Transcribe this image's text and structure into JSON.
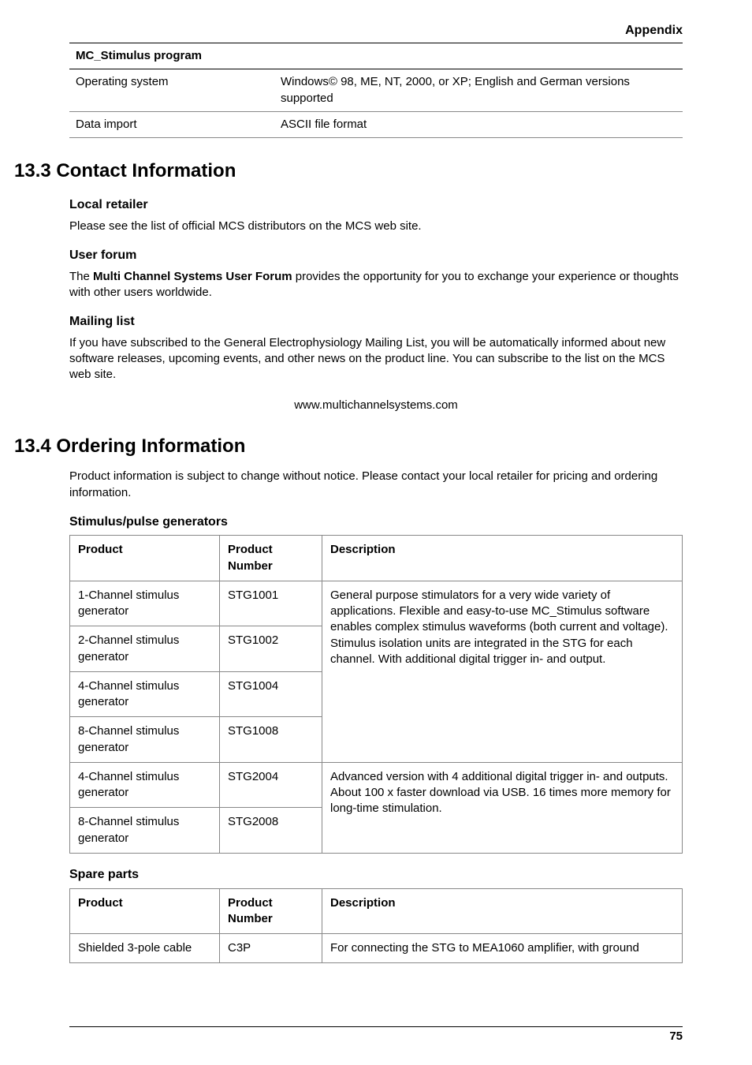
{
  "header": {
    "section": "Appendix"
  },
  "table1": {
    "title": "MC_Stimulus program",
    "rows": [
      {
        "k": "Operating system",
        "v": "Windows© 98, ME, NT, 2000, or XP; English and German versions supported"
      },
      {
        "k": "Data import",
        "v": "ASCII file format"
      }
    ]
  },
  "sec133": {
    "heading": "13.3 Contact Information",
    "h1": "Local retailer",
    "p1": "Please see the list of official MCS distributors on the MCS web site.",
    "h2": "User forum",
    "p2a": "The ",
    "p2b": "Multi Channel Systems User Forum",
    "p2c": " provides the opportunity for you to exchange your experience or thoughts with other users worldwide.",
    "h3": "Mailing list",
    "p3": "If you have subscribed to the General Electrophysiology Mailing List, you will be automatically informed about new software releases, upcoming events, and other news on the product line. You can subscribe to the list on the MCS web site.",
    "url": "www.multichannelsystems.com"
  },
  "sec134": {
    "heading": "13.4 Ordering Information",
    "intro": "Product information is subject to change without notice. Please contact your local retailer for pricing and ordering information.",
    "h1": "Stimulus/pulse generators",
    "th1": "Product",
    "th2": "Product Number",
    "th3": "Description",
    "rows1": [
      {
        "p": "1-Channel stimulus generator",
        "n": "STG1001"
      },
      {
        "p": "2-Channel stimulus generator",
        "n": "STG1002"
      },
      {
        "p": "4-Channel stimulus generator",
        "n": "STG1004"
      },
      {
        "p": "8-Channel stimulus generator",
        "n": "STG1008"
      }
    ],
    "desc1": "General purpose stimulators for a very wide variety of applications. Flexible and easy-to-use MC_Stimulus software enables complex stimulus waveforms (both current and voltage). Stimulus isolation units are integrated in the STG for each channel. With additional digital trigger in- and output.",
    "rows2": [
      {
        "p": "4-Channel stimulus generator",
        "n": "STG2004"
      },
      {
        "p": "8-Channel stimulus generator",
        "n": "STG2008"
      }
    ],
    "desc2": "Advanced version with 4 additional digital trigger in- and outputs. About 100 x faster download via USB. 16 times more memory for long-time stimulation.",
    "h2": "Spare parts",
    "spare": {
      "p": "Shielded 3-pole cable",
      "n": "C3P",
      "d": "For connecting the STG to MEA1060 amplifier, with ground"
    }
  },
  "footer": {
    "page": "75"
  }
}
